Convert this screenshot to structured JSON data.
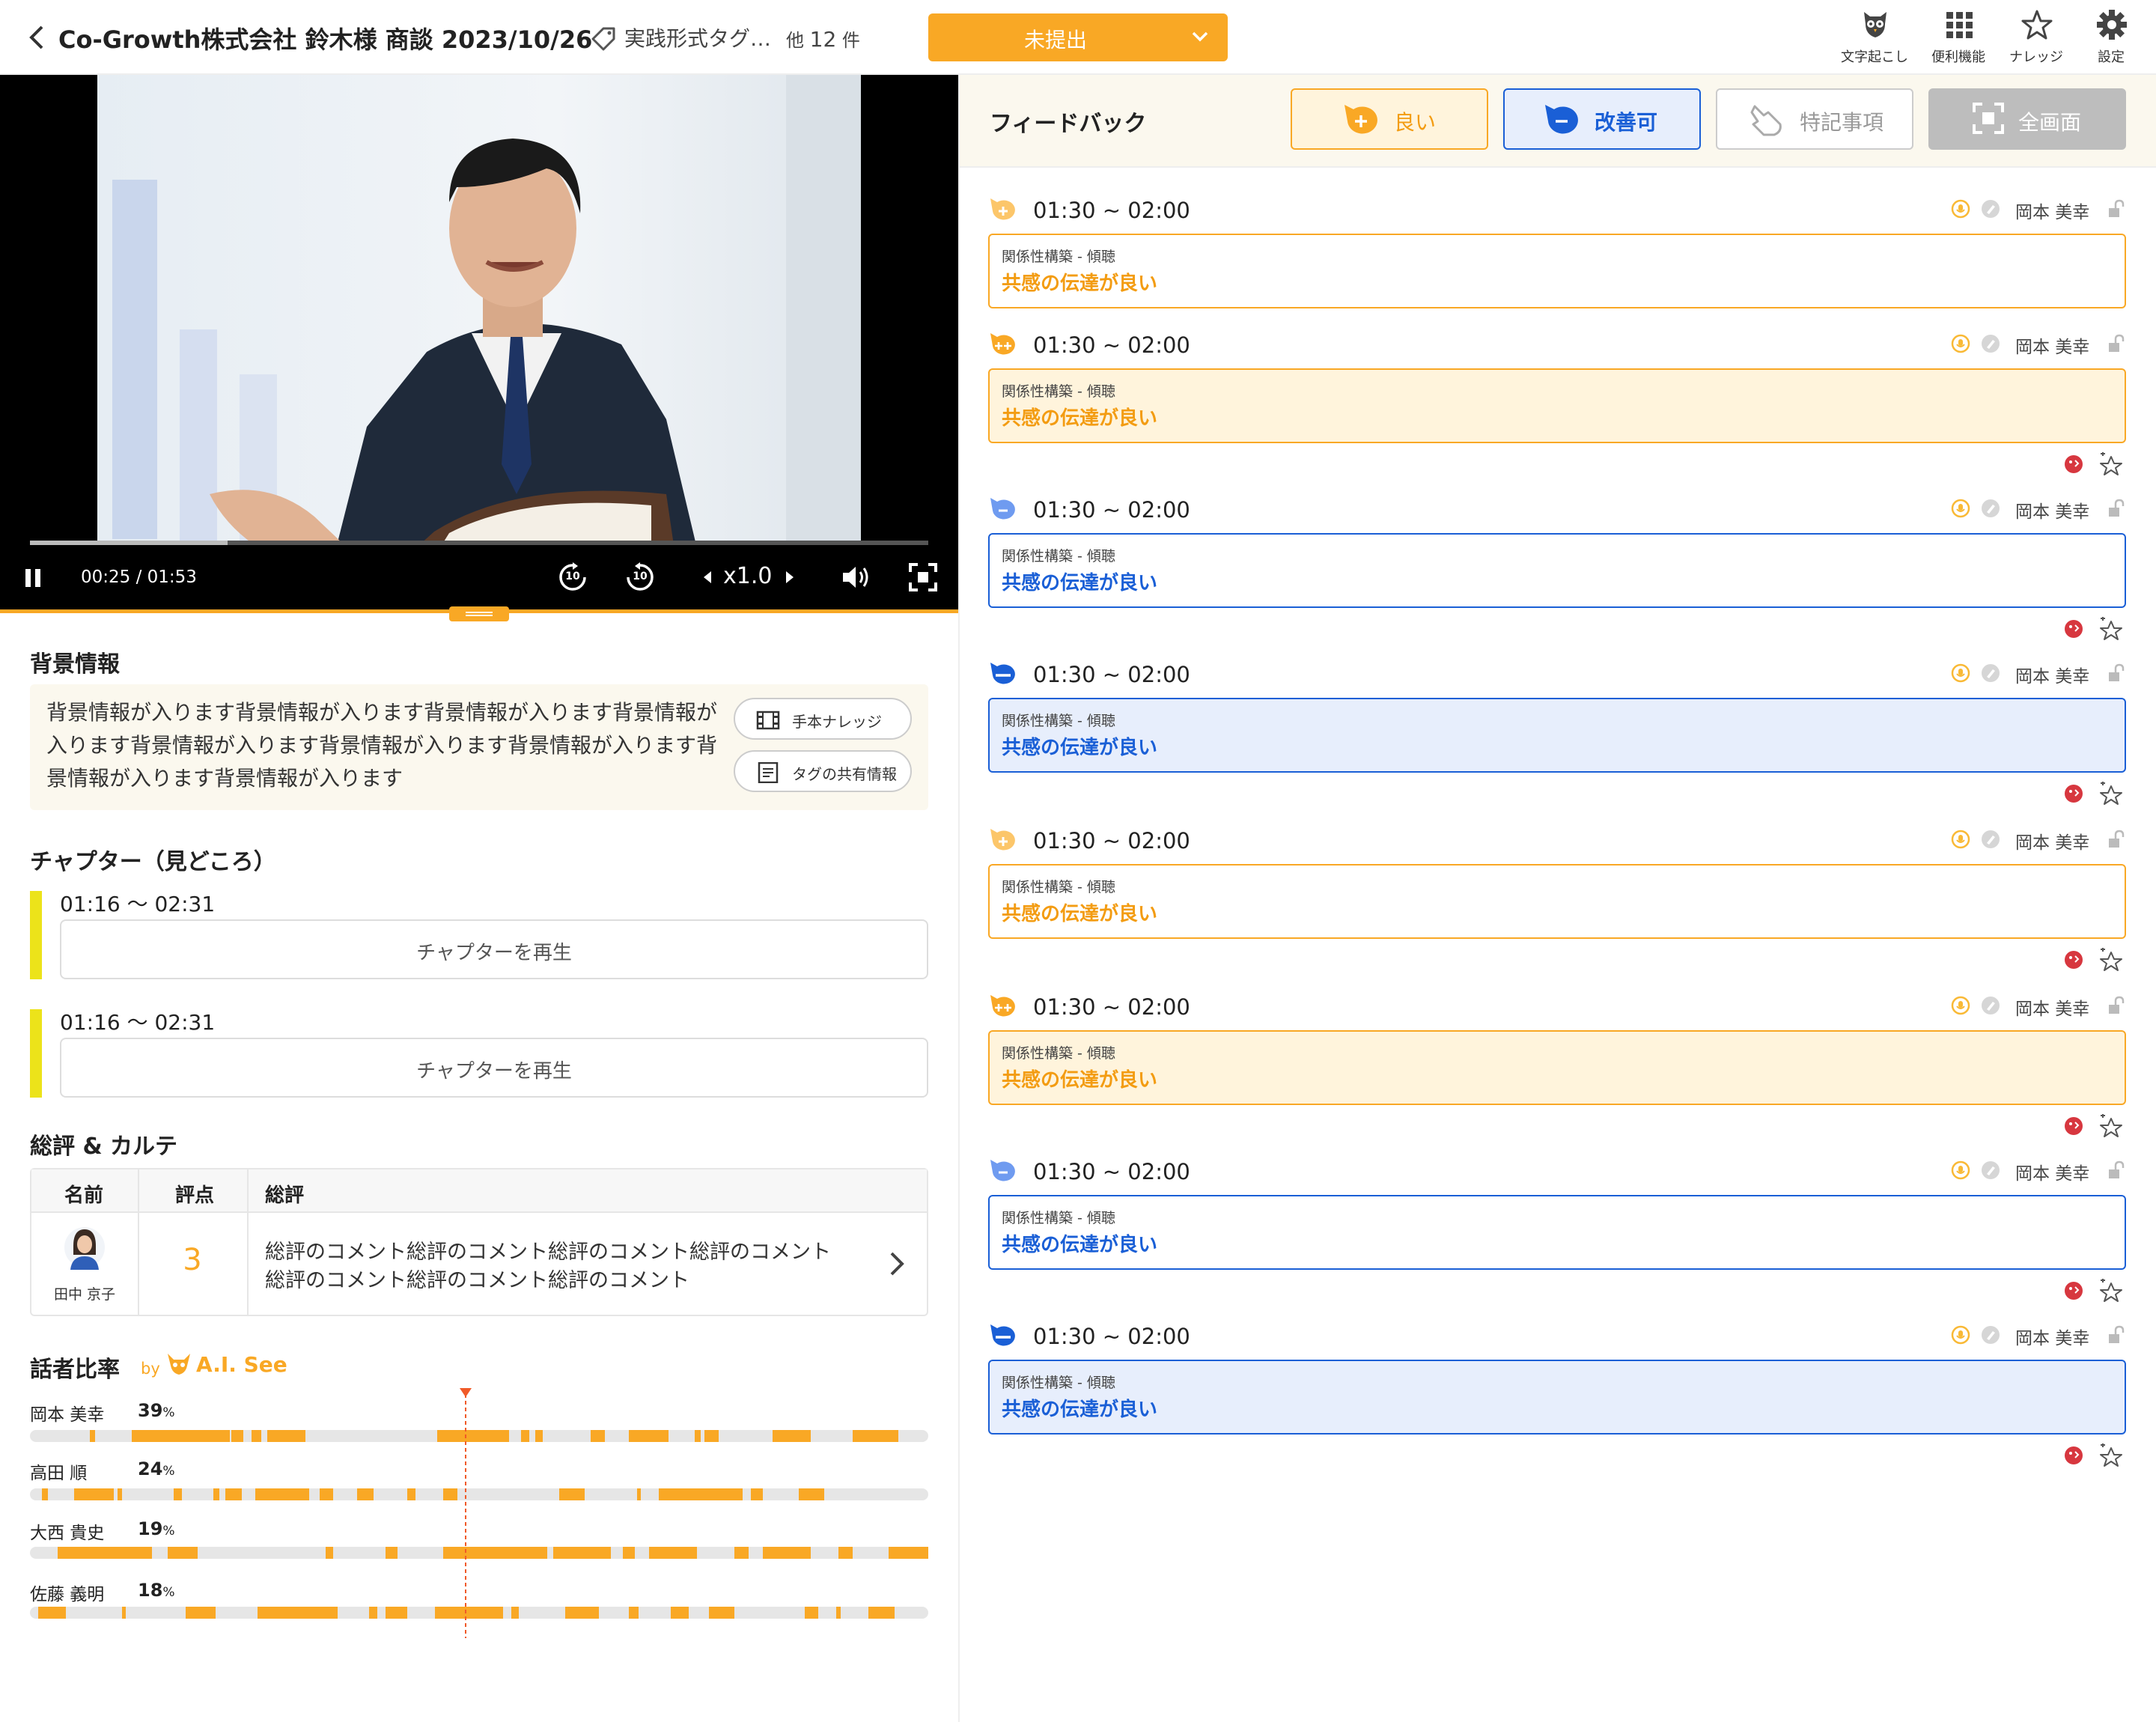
{
  "header": {
    "title": "Co-Growth株式会社 鈴木様 商談 2023/10/26",
    "tag_label": "実践形式タグ…",
    "tag_count_prefix": "他",
    "tag_count": "12",
    "tag_count_suffix": "件",
    "status": "未提出",
    "tools": [
      {
        "label": "文字起こし",
        "icon": "owl-icon"
      },
      {
        "label": "便利機能",
        "icon": "grid-icon"
      },
      {
        "label": "ナレッジ",
        "icon": "star-icon"
      },
      {
        "label": "設定",
        "icon": "gear-icon"
      }
    ]
  },
  "player": {
    "time": "00:25 / 01:53",
    "rewind_label": "10",
    "forward_label": "10",
    "speed": "x1.0",
    "progress": 0.22
  },
  "background": {
    "heading": "背景情報",
    "text": "背景情報が入ります背景情報が入ります背景情報が入ります背景情報が入ります背景情報が入ります背景情報が入ります背景情報が入ります背景情報が入ります背景情報が入ります",
    "btn_model": "手本ナレッジ",
    "btn_tag": "タグの共有情報"
  },
  "chapters": {
    "heading": "チャプター（見どころ）",
    "items": [
      {
        "time": "01:16 〜 02:31",
        "button": "チャプターを再生"
      },
      {
        "time": "01:16 〜 02:31",
        "button": "チャプターを再生"
      }
    ]
  },
  "evaluation": {
    "heading": "総評 & カルテ",
    "col_name": "名前",
    "col_score": "評点",
    "col_review": "総評",
    "row": {
      "name": "田中 京子",
      "score": "3",
      "comment_line1": "総評のコメント総評のコメント総評のコメント総評のコメント",
      "comment_line2": "総評のコメント総評のコメント総評のコメント"
    }
  },
  "speakers": {
    "heading": "話者比率",
    "by": "by",
    "brand": "A.I. See",
    "list": [
      {
        "name": "岡本 美幸",
        "pct": "39",
        "unit": "%"
      },
      {
        "name": "高田 順",
        "pct": "24",
        "unit": "%"
      },
      {
        "name": "大西 貴史",
        "pct": "19",
        "unit": "%"
      },
      {
        "name": "佐藤 義明",
        "pct": "18",
        "unit": "%"
      }
    ]
  },
  "feedback": {
    "heading": "フィードバック",
    "btn_good": "良い",
    "btn_improve": "改善可",
    "btn_special": "特記事項",
    "btn_fullscreen": "全画面",
    "items": [
      {
        "type": "good",
        "time": "01:30 ~ 02:00",
        "category": "関係性構築 - 傾聴",
        "text": "共感の伝達が良い",
        "user": "岡本 美幸"
      },
      {
        "type": "very-good",
        "time": "01:30 ~ 02:00",
        "category": "関係性構築 - 傾聴",
        "text": "共感の伝達が良い",
        "user": "岡本 美幸"
      },
      {
        "type": "improve",
        "time": "01:30 ~ 02:00",
        "category": "関係性構築 - 傾聴",
        "text": "共感の伝達が良い",
        "user": "岡本 美幸"
      },
      {
        "type": "strong-improve",
        "time": "01:30 ~ 02:00",
        "category": "関係性構築 - 傾聴",
        "text": "共感の伝達が良い",
        "user": "岡本 美幸"
      },
      {
        "type": "good",
        "time": "01:30 ~ 02:00",
        "category": "関係性構築 - 傾聴",
        "text": "共感の伝達が良い",
        "user": "岡本 美幸"
      },
      {
        "type": "very-good",
        "time": "01:30 ~ 02:00",
        "category": "関係性構築 - 傾聴",
        "text": "共感の伝達が良い",
        "user": "岡本 美幸"
      },
      {
        "type": "improve",
        "time": "01:30 ~ 02:00",
        "category": "関係性構築 - 傾聴",
        "text": "共感の伝達が良い",
        "user": "岡本 美幸"
      },
      {
        "type": "strong-improve",
        "time": "01:30 ~ 02:00",
        "category": "関係性構築 - 傾聴",
        "text": "共感の伝達が良い",
        "user": "岡本 美幸"
      }
    ]
  },
  "colors": {
    "accent": "#f9a825",
    "blue": "#1a5fd6",
    "chapter_bar": "#ece31a"
  }
}
